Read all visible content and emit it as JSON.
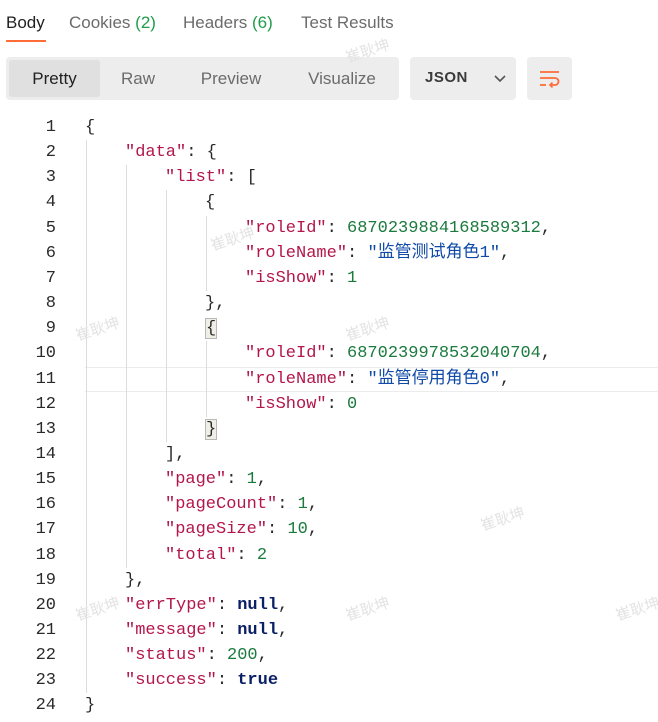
{
  "tabs": {
    "body": "Body",
    "cookies": "Cookies",
    "cookies_count": "(2)",
    "headers": "Headers",
    "headers_count": "(6)",
    "test_results": "Test Results"
  },
  "view_modes": [
    "Pretty",
    "Raw",
    "Preview",
    "Visualize"
  ],
  "format": "JSON",
  "watermark": "崔耿坤",
  "colors": {
    "accent": "#ff6c37",
    "key": "#b3164a",
    "string": "#0f4aa8",
    "number": "#1b7a3e",
    "count": "#1f9d4a"
  },
  "icons": {
    "format_dropdown": "chevron-down-icon",
    "wrap": "wrap-lines-icon"
  },
  "code_lines": [
    [
      "{"
    ],
    [
      "\"data\"",
      ": {"
    ],
    [
      "\"list\"",
      ": ["
    ],
    [
      "{"
    ],
    [
      "\"roleId\"",
      ": ",
      "6870239884168589312",
      ","
    ],
    [
      "\"roleName\"",
      ": ",
      "\"监管测试角色1\"",
      ","
    ],
    [
      "\"isShow\"",
      ": ",
      "1"
    ],
    [
      "},"
    ],
    [
      "{"
    ],
    [
      "\"roleId\"",
      ": ",
      "6870239978532040704",
      ","
    ],
    [
      "\"roleName\"",
      ": ",
      "\"监管停用角色0\"",
      ","
    ],
    [
      "\"isShow\"",
      ": ",
      "0"
    ],
    [
      "}"
    ],
    [
      "],"
    ],
    [
      "\"page\"",
      ": ",
      "1",
      ","
    ],
    [
      "\"pageCount\"",
      ": ",
      "1",
      ","
    ],
    [
      "\"pageSize\"",
      ": ",
      "10",
      ","
    ],
    [
      "\"total\"",
      ": ",
      "2"
    ],
    [
      "},"
    ],
    [
      "\"errType\"",
      ": ",
      "null",
      ","
    ],
    [
      "\"message\"",
      ": ",
      "null",
      ","
    ],
    [
      "\"status\"",
      ": ",
      "200",
      ","
    ],
    [
      "\"success\"",
      ": ",
      "true"
    ],
    [
      "}"
    ]
  ]
}
